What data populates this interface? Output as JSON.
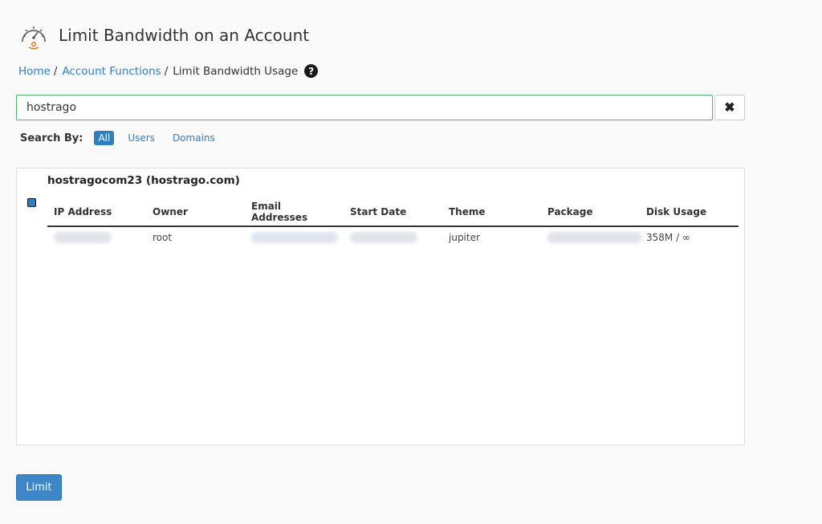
{
  "header": {
    "title": "Limit Bandwidth on an Account",
    "icon": "speedometer-icon"
  },
  "breadcrumb": {
    "items": [
      {
        "label": "Home"
      },
      {
        "label": "Account Functions"
      },
      {
        "label": "Limit Bandwidth Usage"
      }
    ],
    "separator": "/",
    "help_icon": "question-circle-icon",
    "help_glyph": "?"
  },
  "search": {
    "value": "hostrago",
    "clear_icon": "close-icon",
    "clear_glyph": "✖"
  },
  "search_by": {
    "label": "Search By:",
    "filters": [
      "All",
      "Users",
      "Domains"
    ],
    "active": "All"
  },
  "account": {
    "title": "hostragocom23 (hostrago.com)",
    "selected": true,
    "columns": [
      "IP Address",
      "Owner",
      "Email Addresses",
      "Start Date",
      "Theme",
      "Package",
      "Disk Usage"
    ],
    "row": {
      "ip_address": "",
      "owner": "root",
      "email_addresses": "",
      "start_date": "",
      "theme": "jupiter",
      "package": "",
      "disk_usage": "358M / ∞"
    }
  },
  "actions": {
    "limit_label": "Limit"
  },
  "colors": {
    "accent": "#2f7ec0",
    "button": "#3d87c8",
    "input_border": "#4fb36b",
    "icon_orange": "#e8711c"
  }
}
